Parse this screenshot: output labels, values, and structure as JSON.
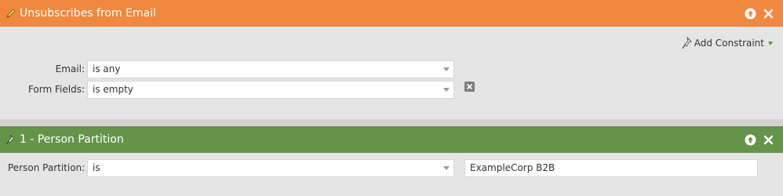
{
  "colors": {
    "orange_header": "#f0883e",
    "green_header": "#63944a",
    "caret_green": "#5a9a3a"
  },
  "filter1": {
    "title": "Unsubscribes from Email",
    "icon": "pencil-icon",
    "add_constraint_label": "Add Constraint",
    "constraints": [
      {
        "label": "Email:",
        "operator": "is any"
      },
      {
        "label": "Form Fields:",
        "operator": "is empty"
      }
    ]
  },
  "filter2": {
    "title": "1 - Person Partition",
    "icon": "pin-icon",
    "constraint": {
      "label": "Person Partition:",
      "operator": "is",
      "value": "ExampleCorp B2B"
    }
  }
}
